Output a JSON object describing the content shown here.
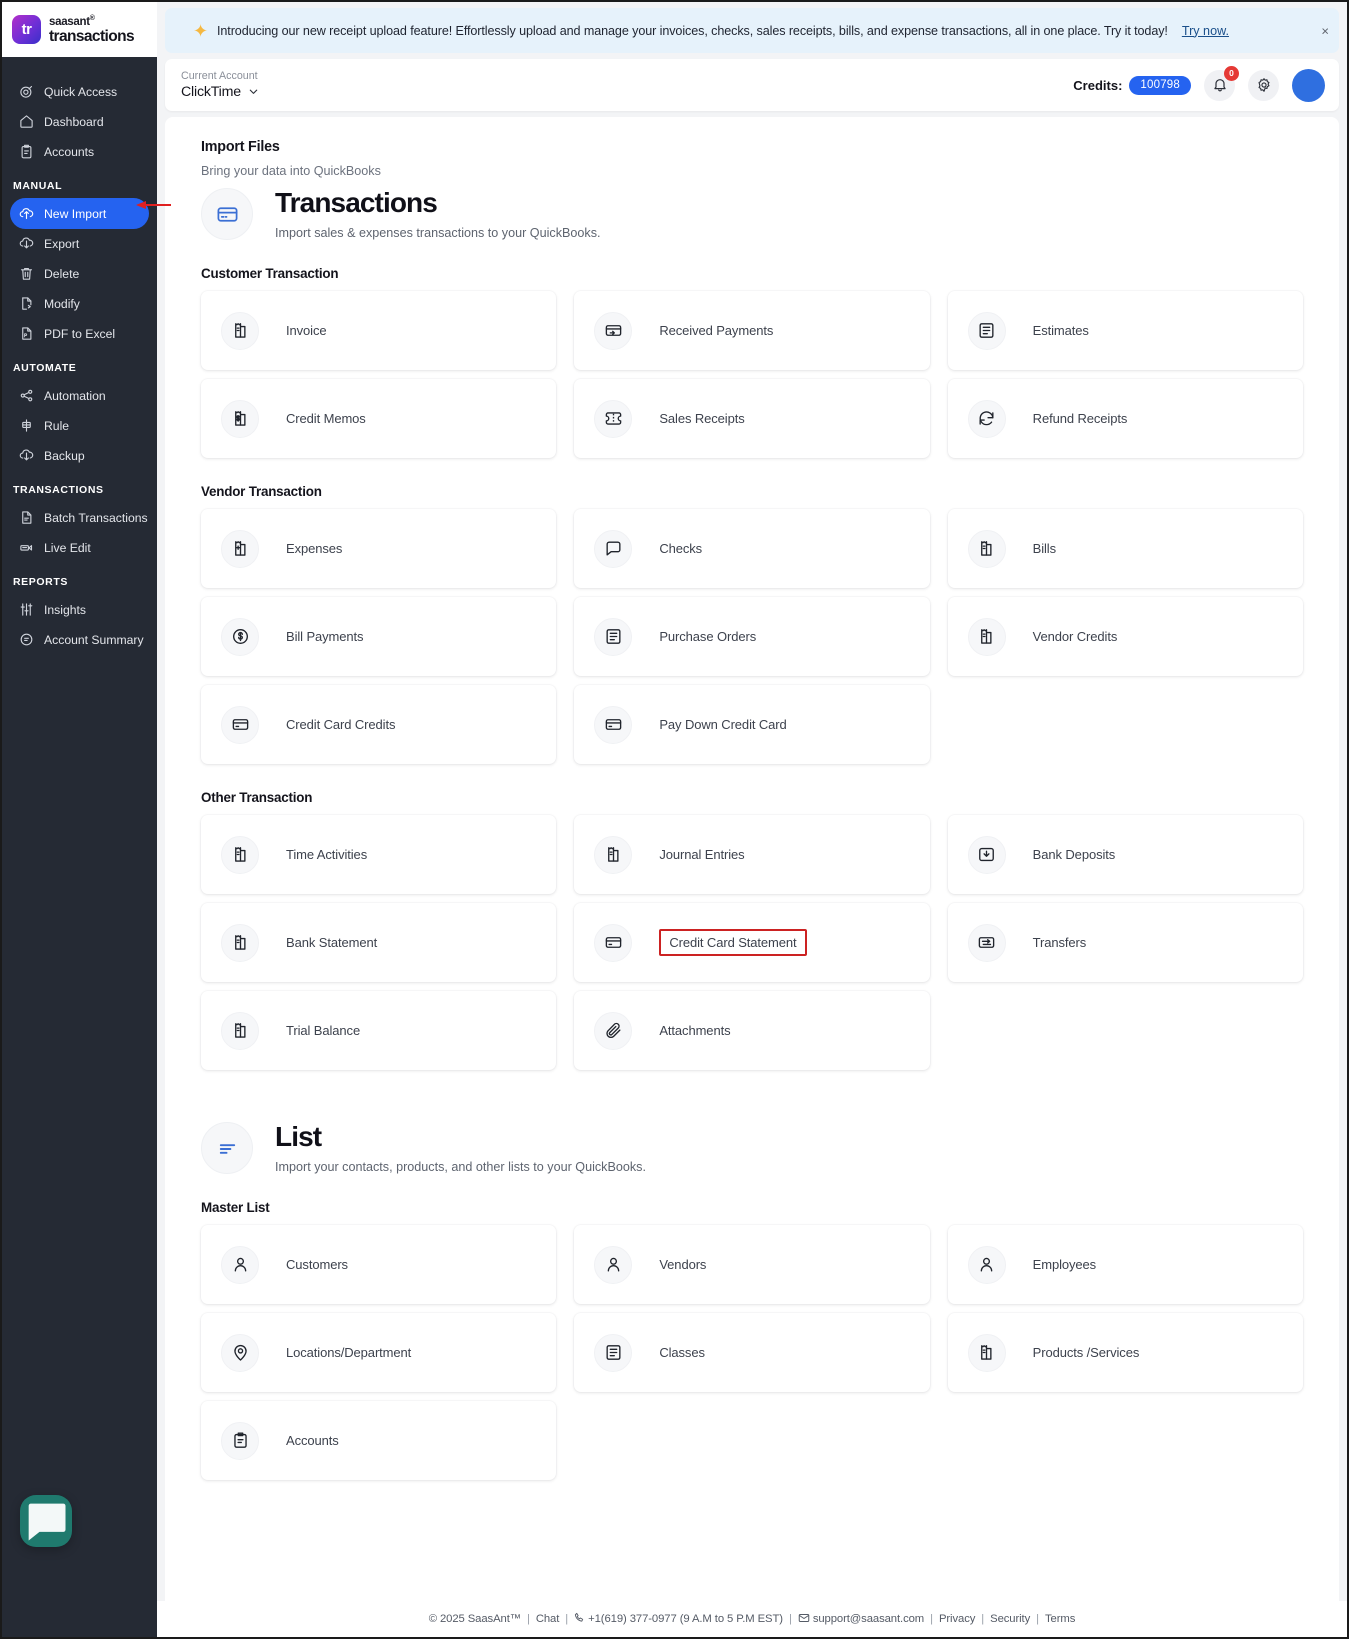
{
  "brand": {
    "top": "saasant",
    "top_sup": "®",
    "bottom": "transactions",
    "mark": "tr"
  },
  "sidebar": {
    "primary": [
      {
        "label": "Quick Access",
        "icon": "target-icon"
      },
      {
        "label": "Dashboard",
        "icon": "home-icon"
      },
      {
        "label": "Accounts",
        "icon": "clipboard-icon"
      }
    ],
    "groups": [
      {
        "label": "MANUAL",
        "items": [
          {
            "label": "New Import",
            "icon": "upload-cloud-icon",
            "active": true
          },
          {
            "label": "Export",
            "icon": "download-cloud-icon",
            "active": false
          },
          {
            "label": "Delete",
            "icon": "trash-icon",
            "active": false
          },
          {
            "label": "Modify",
            "icon": "file-edit-icon",
            "active": false
          },
          {
            "label": "PDF to Excel",
            "icon": "pdf-file-icon",
            "active": false
          }
        ]
      },
      {
        "label": "AUTOMATE",
        "items": [
          {
            "label": "Automation",
            "icon": "share-nodes-icon",
            "active": false
          },
          {
            "label": "Rule",
            "icon": "rule-icon",
            "active": false
          },
          {
            "label": "Backup",
            "icon": "backup-cloud-icon",
            "active": false
          }
        ]
      },
      {
        "label": "TRANSACTIONS",
        "items": [
          {
            "label": "Batch Transactions",
            "icon": "document-icon",
            "active": false
          },
          {
            "label": "Live Edit",
            "icon": "live-edit-icon",
            "active": false
          }
        ]
      },
      {
        "label": "REPORTS",
        "items": [
          {
            "label": "Insights",
            "icon": "sliders-icon",
            "active": false
          },
          {
            "label": "Account Summary",
            "icon": "summary-icon",
            "active": false
          }
        ]
      }
    ]
  },
  "banner": {
    "icon": "sparkle-icon",
    "text": "Introducing our new receipt upload feature! Effortlessly upload and manage your invoices, checks, sales receipts, bills, and expense transactions, all in one place. Try it today!",
    "link": "Try now.",
    "close": "×"
  },
  "topbar": {
    "account_label": "Current Account",
    "account_name": "ClickTime",
    "chevron": "chevron-down-icon",
    "credits_label": "Credits:",
    "credits_value": "100798",
    "notification_icon": "bell-icon",
    "notification_badge": "0",
    "settings_icon": "gear-icon",
    "avatar": "user-avatar",
    "accent": "#2563f0"
  },
  "page": {
    "kicker": "Import Files",
    "sub": "Bring your data into QuickBooks"
  },
  "transactions_hero": {
    "icon": "credit-card-icon",
    "title": "Transactions",
    "desc": "Import sales & expenses transactions to your QuickBooks."
  },
  "list_hero": {
    "icon": "list-lines-icon",
    "title": "List",
    "desc": "Import your contacts, products, and other lists to your QuickBooks."
  },
  "sections": [
    {
      "title": "Customer Transaction",
      "cards": [
        {
          "label": "Invoice",
          "icon": "receipt-icon",
          "highlight": false
        },
        {
          "label": "Received Payments",
          "icon": "payment-card-icon",
          "highlight": false
        },
        {
          "label": "Estimates",
          "icon": "estimate-doc-icon",
          "highlight": false
        },
        {
          "label": "Credit Memos",
          "icon": "money-receipt-icon",
          "highlight": false
        },
        {
          "label": "Sales Receipts",
          "icon": "ticket-icon",
          "highlight": false
        },
        {
          "label": "Refund Receipts",
          "icon": "refund-arrows-icon",
          "highlight": false
        }
      ]
    },
    {
      "title": "Vendor Transaction",
      "cards": [
        {
          "label": "Expenses",
          "icon": "expense-receipt-icon",
          "highlight": false
        },
        {
          "label": "Checks",
          "icon": "check-icon",
          "highlight": false
        },
        {
          "label": "Bills",
          "icon": "receipt-icon",
          "highlight": false
        },
        {
          "label": "Bill Payments",
          "icon": "dollar-circle-icon",
          "highlight": false
        },
        {
          "label": "Purchase Orders",
          "icon": "estimate-doc-icon",
          "highlight": false
        },
        {
          "label": "Vendor Credits",
          "icon": "receipt-icon",
          "highlight": false
        },
        {
          "label": "Credit Card Credits",
          "icon": "credit-card-icon",
          "highlight": false
        },
        {
          "label": "Pay Down Credit Card",
          "icon": "credit-card-icon",
          "highlight": false
        },
        {
          "label": "",
          "icon": "",
          "highlight": false
        }
      ]
    },
    {
      "title": "Other Transaction",
      "cards": [
        {
          "label": "Time Activities",
          "icon": "receipt-icon",
          "highlight": false
        },
        {
          "label": "Journal Entries",
          "icon": "receipt-icon",
          "highlight": false
        },
        {
          "label": "Bank Deposits",
          "icon": "bank-deposit-icon",
          "highlight": false
        },
        {
          "label": "Bank Statement",
          "icon": "receipt-icon",
          "highlight": false
        },
        {
          "label": "Credit Card Statement",
          "icon": "credit-card-icon",
          "highlight": true
        },
        {
          "label": "Transfers",
          "icon": "transfer-icon",
          "highlight": false
        },
        {
          "label": "Trial Balance",
          "icon": "receipt-icon",
          "highlight": false
        },
        {
          "label": "Attachments",
          "icon": "paperclip-icon",
          "highlight": false
        },
        {
          "label": "",
          "icon": "",
          "highlight": false
        }
      ]
    }
  ],
  "master_list": {
    "title": "Master List",
    "cards": [
      {
        "label": "Customers",
        "icon": "person-icon",
        "highlight": false
      },
      {
        "label": "Vendors",
        "icon": "person-icon",
        "highlight": false
      },
      {
        "label": "Employees",
        "icon": "person-icon",
        "highlight": false
      },
      {
        "label": "Locations/Department",
        "icon": "map-pin-icon",
        "highlight": false
      },
      {
        "label": "Classes",
        "icon": "estimate-doc-icon",
        "highlight": false
      },
      {
        "label": "Products /Services",
        "icon": "receipt-icon",
        "highlight": false
      },
      {
        "label": "Accounts",
        "icon": "clipboard-icon",
        "highlight": false
      },
      {
        "label": "",
        "icon": "",
        "highlight": false
      },
      {
        "label": "",
        "icon": "",
        "highlight": false
      }
    ]
  },
  "footer": {
    "copyright": "© 2025 SaasAnt™",
    "chat": "Chat",
    "phone": "+1(619) 377-0977 (9 A.M to 5 P.M EST)",
    "email": "support@saasant.com",
    "privacy": "Privacy",
    "security": "Security",
    "terms": "Terms",
    "phone_icon": "phone-icon",
    "mail_icon": "mail-icon"
  },
  "chat_widget": {
    "icon": "chat-bubble-icon"
  }
}
